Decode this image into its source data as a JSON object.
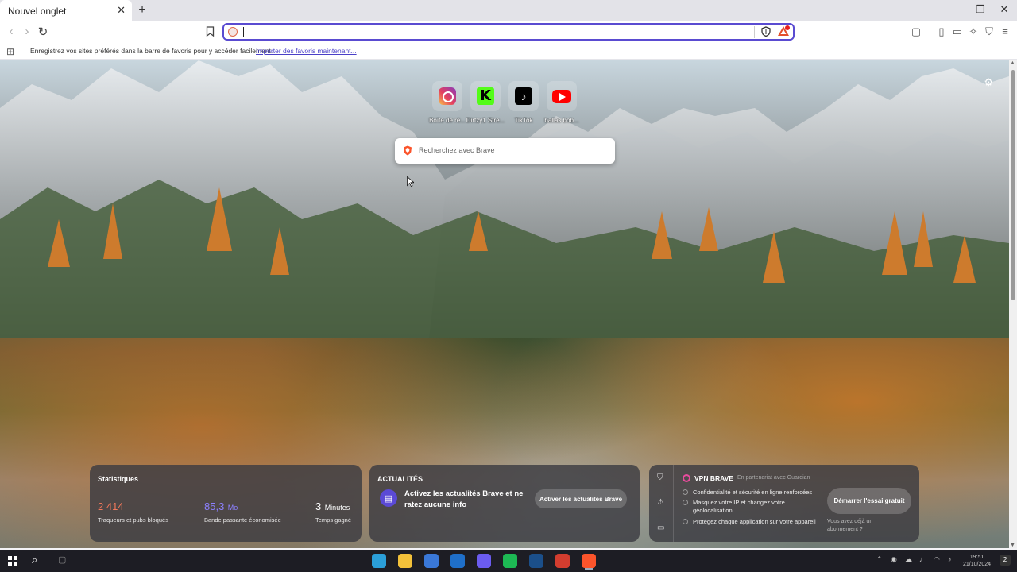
{
  "tab": {
    "title": "Nouvel onglet",
    "close_glyph": "✕",
    "new_tab_glyph": "+"
  },
  "window_controls": {
    "minimize": "–",
    "restore": "❐",
    "close": "✕"
  },
  "toolbar": {
    "back_glyph": "‹",
    "forward_glyph": "›",
    "reload_glyph": "↻",
    "bookmark_glyph": "🔖",
    "url_value": "",
    "icons": [
      "shield-icon",
      "bat-rewards-icon",
      "sidebar-icon",
      "wallet-icon",
      "leo-ai-icon",
      "vpn-icon",
      "menu-icon"
    ]
  },
  "bookmarks_bar": {
    "message": "Enregistrez vos sites préférés dans la barre de favoris pour y accéder facilement.",
    "import_link": "Importer des favoris maintenant..."
  },
  "top_sites": [
    {
      "label": "Boîte de ré...",
      "icon": "instagram-icon"
    },
    {
      "label": "Dirtzy1 Stre...",
      "icon": "kick-icon",
      "glyph": "K"
    },
    {
      "label": "TikTok",
      "icon": "tiktok-icon",
      "glyph": "♪"
    },
    {
      "label": "ballas bob...",
      "icon": "youtube-icon"
    }
  ],
  "search": {
    "placeholder": "Recherchez avec Brave"
  },
  "stats": {
    "title": "Statistiques",
    "trackers": {
      "value": "2 414",
      "desc": "Traqueurs et pubs bloqués",
      "color": "#f2785a"
    },
    "bandwidth": {
      "value": "85,3",
      "unit": "Mo",
      "desc": "Bande passante économisée",
      "color": "#8c80ff"
    },
    "time": {
      "value": "3",
      "unit": "Minutes",
      "desc": "Temps gagné",
      "color": "#ffffff"
    }
  },
  "news": {
    "title": "ACTUALITÉS",
    "text": "Activez les actualités Brave et ne ratez aucune info",
    "button": "Activer les actualités Brave"
  },
  "vpn": {
    "title": "VPN BRAVE",
    "partner": "En partenariat avec  Guardian",
    "features": [
      "Confidentialité et sécurité en ligne renforcées",
      "Masquez votre IP et changez votre géolocalisation",
      "Protégez chaque application sur votre appareil"
    ],
    "cta": "Démarrer l'essai gratuit",
    "already": "Vous avez déjà un abonnement ?"
  },
  "taskbar": {
    "apps": [
      {
        "name": "edge-icon",
        "color": "#2b9fd9"
      },
      {
        "name": "file-explorer-icon",
        "color": "#f3c13a"
      },
      {
        "name": "calculator-icon",
        "color": "#3a78d8"
      },
      {
        "name": "outlook-icon",
        "color": "#1f6fc9"
      },
      {
        "name": "discord-icon",
        "color": "#6b5cf0"
      },
      {
        "name": "spotify-icon",
        "color": "#1db954"
      },
      {
        "name": "steam-icon",
        "color": "#1b4f8a"
      },
      {
        "name": "chrome-icon",
        "color": "#d33d2f"
      },
      {
        "name": "brave-icon",
        "color": "#fb542b"
      }
    ],
    "clock_time": "19:51",
    "clock_date": "21/10/2024",
    "notifications": "2"
  },
  "colors": {
    "accent": "#5a4bd1",
    "brave_orange": "#fb542b"
  }
}
